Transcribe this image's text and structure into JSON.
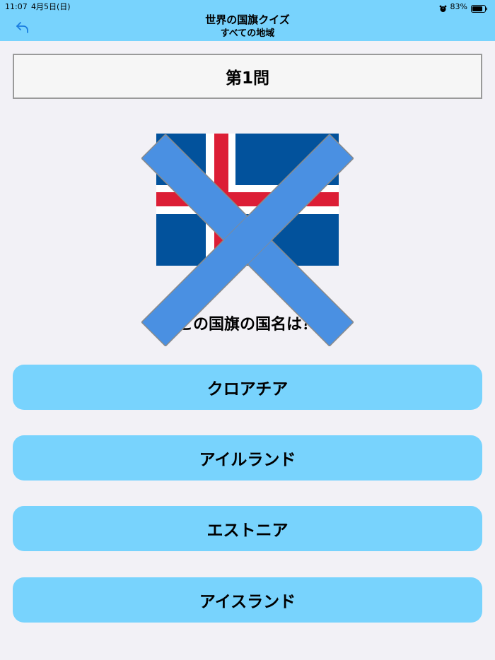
{
  "status_bar": {
    "time": "11:07",
    "date": "4月5日(日)",
    "battery": "83%"
  },
  "nav": {
    "title": "世界の国旗クイズ",
    "subtitle": "すべての地域",
    "back_icon": "back-arrow-icon"
  },
  "question": {
    "number_label": "第1問",
    "prompt": "この国旗の国名は？"
  },
  "flag": {
    "icon": "iceland-flag",
    "colors": {
      "blue": "#02529c",
      "white": "#ffffff",
      "red": "#dc1e35"
    }
  },
  "result_mark": {
    "icon": "wrong-x-mark",
    "color": "#4a90e2"
  },
  "answers": [
    {
      "label": "クロアチア"
    },
    {
      "label": "アイルランド"
    },
    {
      "label": "エストニア"
    },
    {
      "label": "アイスランド"
    }
  ],
  "colors": {
    "accent": "#78d3fd",
    "background": "#f2f1f6",
    "back_icon": "#1a7de0"
  }
}
